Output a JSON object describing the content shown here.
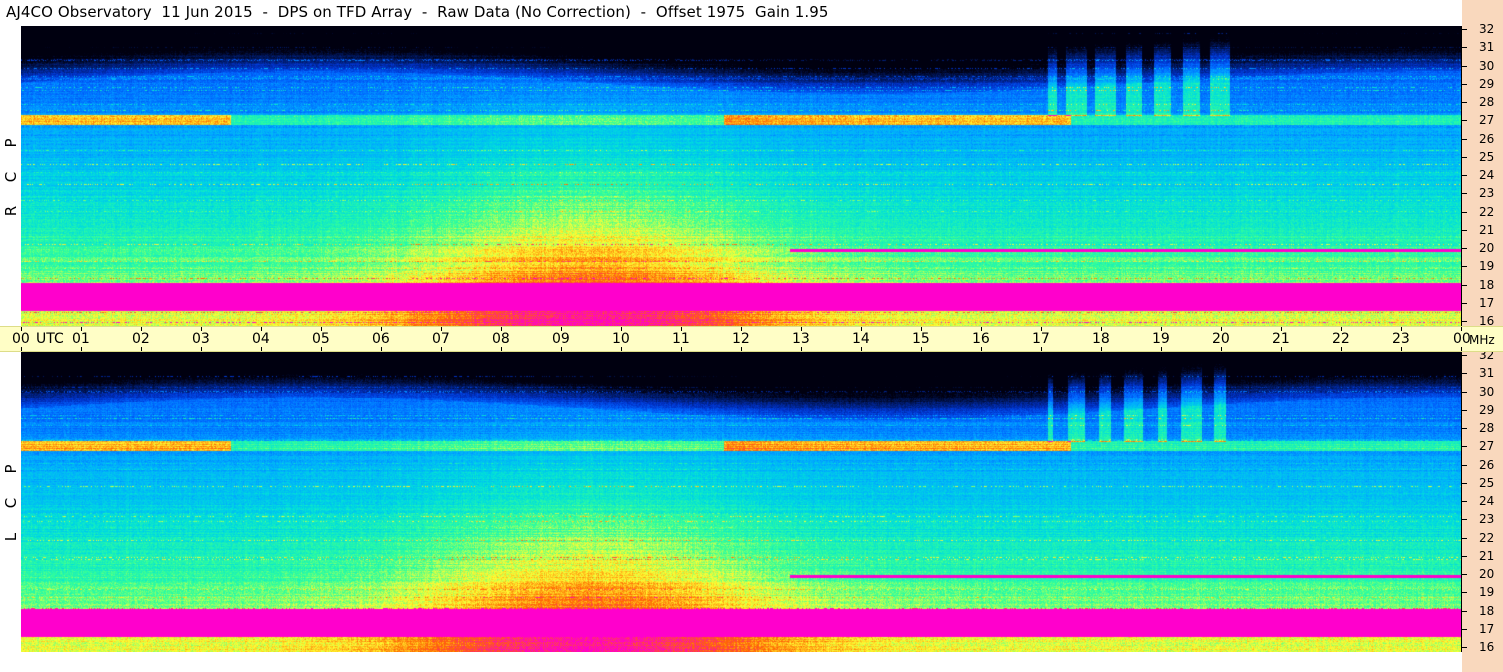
{
  "header": {
    "title": "AJ4CO Observatory  11 Jun 2015  -  DPS on TFD Array  -  Raw Data (No Correction)  -  Offset 1975  Gain 1.95"
  },
  "panels": [
    {
      "id": "rcp",
      "polarization": [
        "R",
        "C",
        "P"
      ]
    },
    {
      "id": "lcp",
      "polarization": [
        "L",
        "C",
        "P"
      ]
    }
  ],
  "time_axis": {
    "unit_label": "UTC",
    "labels": [
      "00",
      "01",
      "02",
      "03",
      "04",
      "05",
      "06",
      "07",
      "08",
      "09",
      "10",
      "11",
      "12",
      "13",
      "14",
      "15",
      "16",
      "17",
      "18",
      "19",
      "20",
      "21",
      "22",
      "23",
      "00"
    ],
    "end_unit": "MHz"
  },
  "freq_axis": {
    "labels": [
      "32",
      "31",
      "30",
      "29",
      "28",
      "27",
      "26",
      "25",
      "24",
      "23",
      "22",
      "21",
      "20",
      "19",
      "18",
      "17",
      "16"
    ]
  },
  "chart_data": {
    "type": "heatmap",
    "title": "AJ4CO Observatory  11 Jun 2015  -  DPS on TFD Array  -  Raw Data (No Correction)  -  Offset 1975  Gain 1.95",
    "xlabel": "UTC",
    "ylabel": "MHz",
    "x_range": [
      0,
      24
    ],
    "y_range": [
      16,
      32
    ],
    "panels": [
      "RCP",
      "LCP"
    ],
    "colormap": [
      "#000010",
      "#001a66",
      "#0033cc",
      "#0066ff",
      "#00aaff",
      "#00dddd",
      "#33ff99",
      "#ffff33",
      "#ff6600",
      "#ff00cc"
    ],
    "features": {
      "ionospheric_cutoff_mhz": 29,
      "persistent_band_mhz": 27,
      "strong_low_band_mhz": [
        17,
        18
      ],
      "carrier_line_mhz": 20,
      "burst_interval_utc": [
        17.1,
        20.4
      ]
    }
  }
}
